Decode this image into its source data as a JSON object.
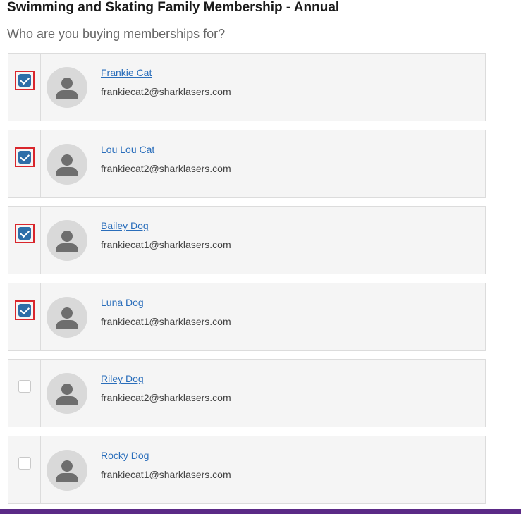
{
  "page": {
    "title": "Swimming and Skating Family Membership - Annual",
    "subtitle": "Who are you buying memberships for?"
  },
  "members": [
    {
      "name": "Frankie Cat",
      "email": "frankiecat2@sharklasers.com",
      "checked": true,
      "highlighted": true
    },
    {
      "name": "Lou Lou Cat",
      "email": "frankiecat2@sharklasers.com",
      "checked": true,
      "highlighted": true
    },
    {
      "name": "Bailey Dog",
      "email": "frankiecat1@sharklasers.com",
      "checked": true,
      "highlighted": true
    },
    {
      "name": "Luna Dog",
      "email": "frankiecat1@sharklasers.com",
      "checked": true,
      "highlighted": true
    },
    {
      "name": "Riley Dog",
      "email": "frankiecat2@sharklasers.com",
      "checked": false,
      "highlighted": false
    },
    {
      "name": "Rocky Dog",
      "email": "frankiecat1@sharklasers.com",
      "checked": false,
      "highlighted": false
    }
  ],
  "icons": {
    "checkbox": "checkbox-icon",
    "avatar": "user-avatar-icon"
  },
  "colors": {
    "link": "#2a6ebb",
    "checked": "#2d6ea8",
    "highlight": "#d9262c",
    "bottom_bar": "#5b2a86"
  }
}
